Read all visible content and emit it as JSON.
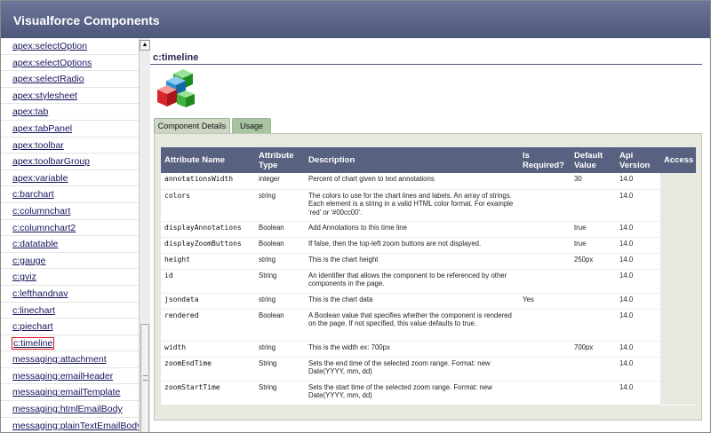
{
  "app": {
    "title": "Visualforce Components"
  },
  "sidebar": {
    "items": [
      "apex:selectOption",
      "apex:selectOptions",
      "apex:selectRadio",
      "apex:stylesheet",
      "apex:tab",
      "apex:tabPanel",
      "apex:toolbar",
      "apex:toolbarGroup",
      "apex:variable",
      "c:barchart",
      "c:columnchart",
      "c:columnchart2",
      "c:datatable",
      "c:gauge",
      "c:gviz",
      "c:lefthandnav",
      "c:linechart",
      "c:piechart",
      "c:timeline",
      "messaging:attachment",
      "messaging:emailHeader",
      "messaging:emailTemplate",
      "messaging:htmlEmailBody",
      "messaging:plainTextEmailBody"
    ],
    "selected": "c:timeline",
    "scroll_up_glyph": "▲"
  },
  "component": {
    "title": "c:timeline",
    "logo_icon": "cubes-icon",
    "tabs": {
      "details": "Component Details",
      "usage": "Usage"
    }
  },
  "attributes": {
    "headers": {
      "name": "Attribute Name",
      "type": "Attribute Type",
      "description": "Description",
      "required": "Is Required?",
      "default": "Default Value",
      "api": "Api Version",
      "access": "Access"
    },
    "rows": [
      {
        "name": "annotationsWidth",
        "type": "integer",
        "description": "Percent of chart given to text annotations",
        "required": "",
        "default": "30",
        "api": "14.0"
      },
      {
        "name": "colors",
        "type": "string",
        "description": "The colors to use for the chart lines and labels. An array of strings. Each element is a string in a valid HTML color format. For example 'red' or '#00cc00'.",
        "required": "",
        "default": "",
        "api": "14.0"
      },
      {
        "name": "displayAnnotations",
        "type": "Boolean",
        "description": "Add Annotations to this time line",
        "required": "",
        "default": "true",
        "api": "14.0"
      },
      {
        "name": "displayZoomButtons",
        "type": "Boolean",
        "description": "If false, then the top-left zoom buttons are not displayed.",
        "required": "",
        "default": "true",
        "api": "14.0"
      },
      {
        "name": "height",
        "type": "string",
        "description": "This is the chart height",
        "required": "",
        "default": "250px",
        "api": "14.0"
      },
      {
        "name": "id",
        "type": "String",
        "description": "An identifier that allows the component to be referenced by other components in the page.",
        "required": "",
        "default": "",
        "api": "14.0"
      },
      {
        "name": "jsondata",
        "type": "string",
        "description": "This is the chart data",
        "required": "Yes",
        "default": "",
        "api": "14.0"
      },
      {
        "name": "rendered",
        "type": "Boolean",
        "description": "A Boolean value that specifies whether the component is rendered on the page. If not specified, this value defaults to true.",
        "required": "",
        "default": "",
        "api": "14.0"
      },
      {
        "name": "width",
        "type": "string",
        "description": "This is the width ex: 700px",
        "required": "",
        "default": "700px",
        "api": "14.0"
      },
      {
        "name": "zoomEndTime",
        "type": "String",
        "description": "Sets the end time of the selected zoom range. Format: new Date(YYYY, mm, dd)",
        "required": "",
        "default": "",
        "api": "14.0"
      },
      {
        "name": "zoomStartTime",
        "type": "String",
        "description": "Sets the start time of the selected zoom range. Format: new Date(YYYY, mm, dd)",
        "required": "",
        "default": "",
        "api": "14.0"
      }
    ]
  },
  "colors": {
    "header": "#4c577b",
    "link": "#15155e",
    "selected_border": "#e2141e",
    "table_header": "#58617f",
    "panel_bg": "#e7e8df"
  }
}
